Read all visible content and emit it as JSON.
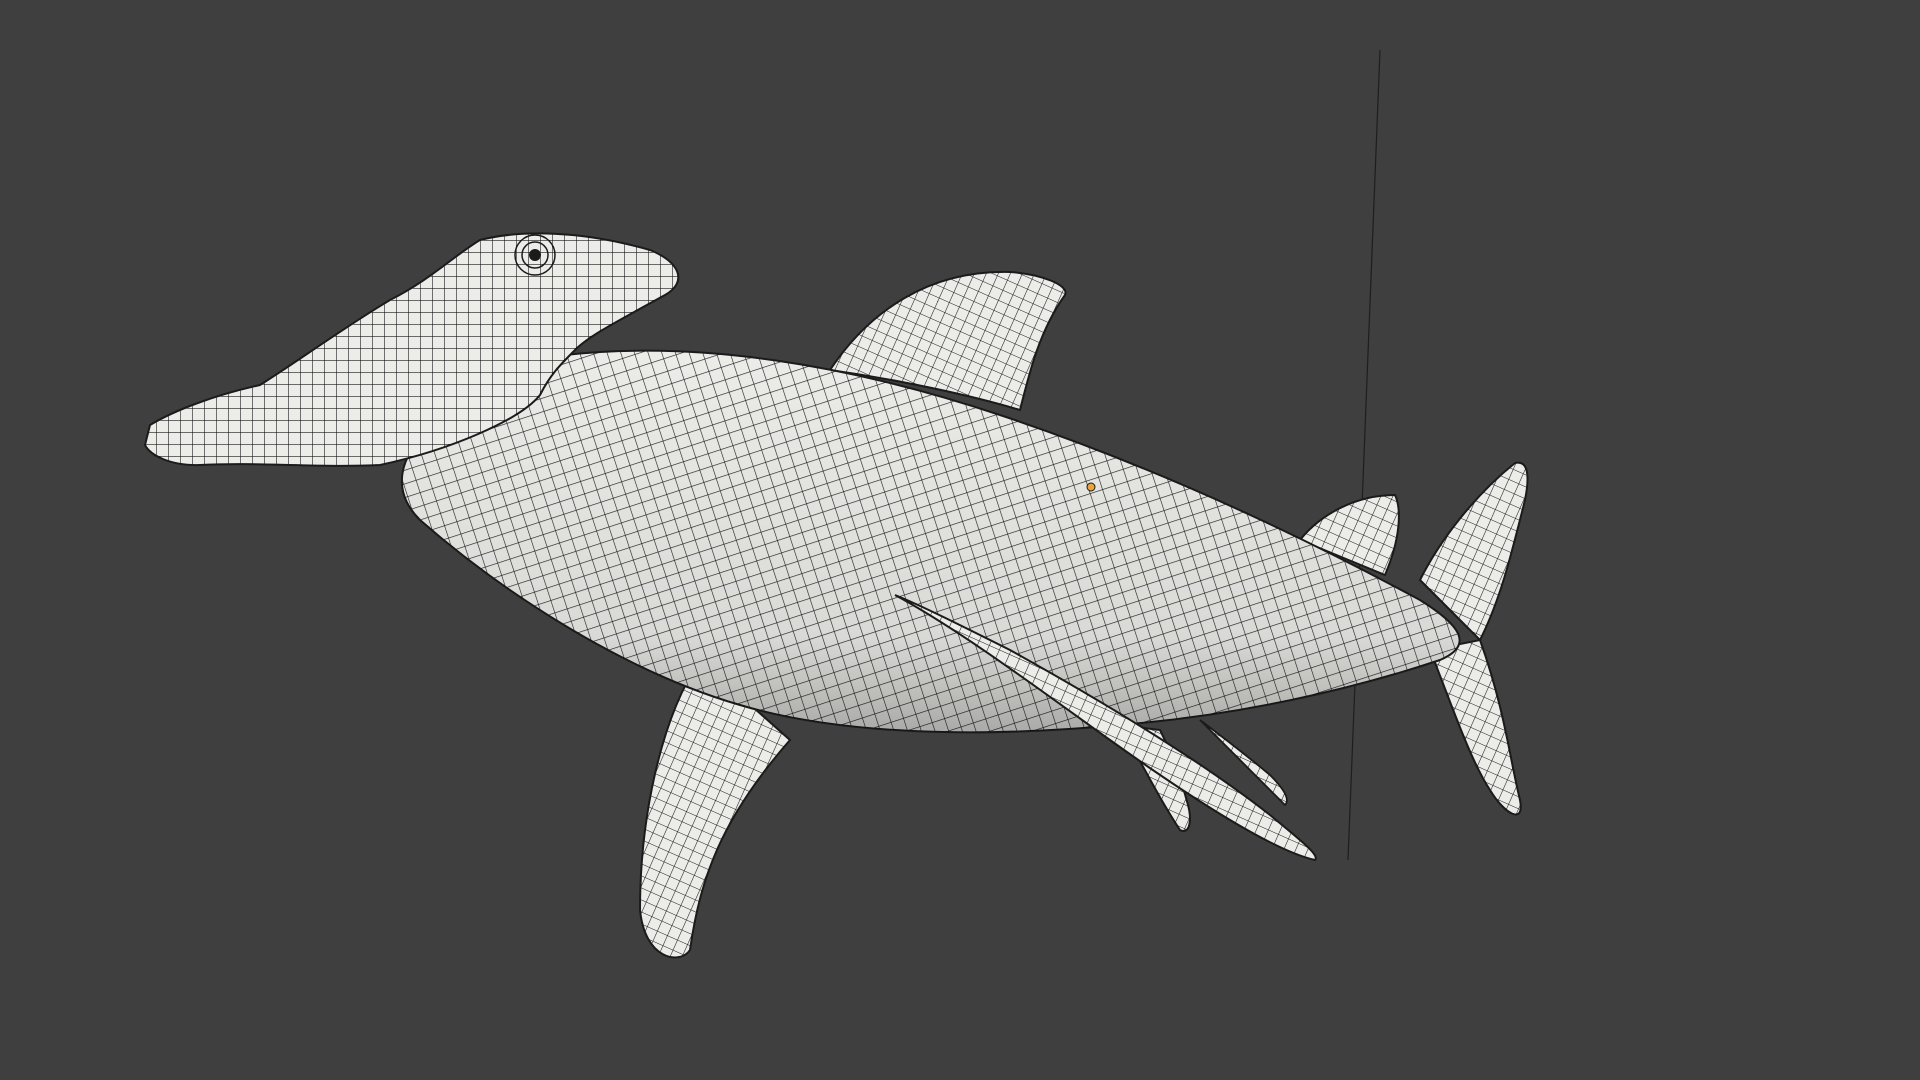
{
  "viewport": {
    "background_color": "#3f3f3f",
    "mesh_fill_color": "#ecece9",
    "wire_color": "#1b1b1b"
  },
  "model": {
    "subject_icon": "hammerhead-shark-icon",
    "display_mode": "solid-with-wireframe"
  },
  "origin_marker": {
    "icon": "object-origin-dot-icon",
    "color": "#e8a33a"
  }
}
